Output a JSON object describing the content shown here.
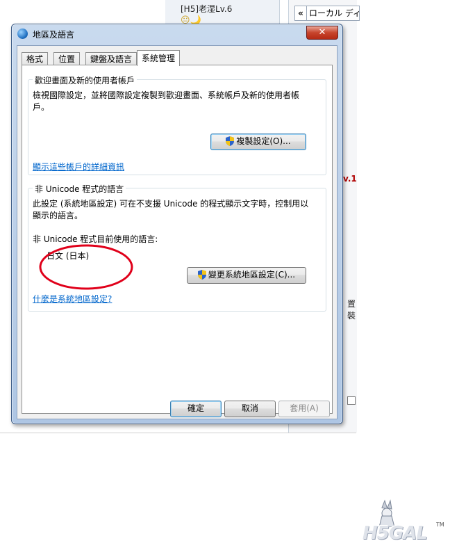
{
  "background": {
    "forum_user": "[H5]老湿Lv.6",
    "forum_emoji": "😐🌙",
    "local_tab_arrow": "«",
    "local_tab_label": "ローカル ディ",
    "lv_fragment": "v.1",
    "install_fragment": "置裝"
  },
  "window": {
    "title": "地區及語言",
    "close_symbol": "✕"
  },
  "tabs": [
    "格式",
    "位置",
    "鍵盤及語言",
    "系統管理"
  ],
  "active_tab": "系統管理",
  "welcome_group": {
    "title": "歡迎畫面及新的使用者帳戶",
    "description_line1": "檢視國際設定，並將國際設定複製到歡迎畫面、系統帳戶及新的使用者帳",
    "description_line2": "戶。",
    "copy_button": "複製設定(O)...",
    "details_link": "顯示這些帳戶的詳細資訊"
  },
  "unicode_group": {
    "title": "非 Unicode 程式的語言",
    "description_line1": "此設定 (系統地區設定) 可在不支援 Unicode 的程式顯示文字時，控制用以",
    "description_line2": "顯示的語言。",
    "current_label": "非 Unicode 程式目前使用的語言:",
    "current_language": "日文 (日本)",
    "change_button": "變更系統地區設定(C)...",
    "help_link": "什麼是系統地區設定?"
  },
  "footer": {
    "ok": "確定",
    "cancel": "取消",
    "apply": "套用(A)"
  },
  "watermark": {
    "text": "H5GAL",
    "tm": "TM"
  },
  "colors": {
    "link": "#0066cc",
    "annotation_ellipse": "#e0001a",
    "close_button": "#c7442c"
  }
}
